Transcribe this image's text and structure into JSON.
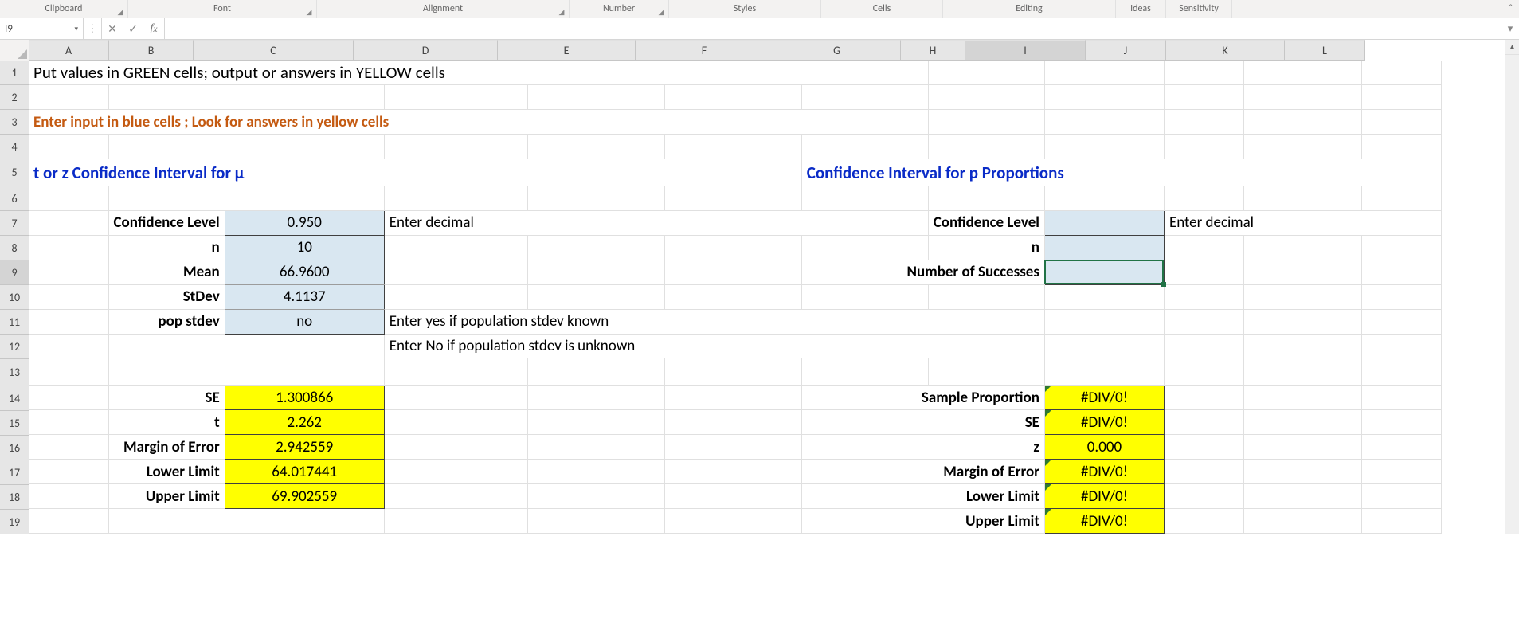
{
  "ribbon": {
    "groups": [
      "Clipboard",
      "Font",
      "Alignment",
      "Number",
      "Styles",
      "Cells",
      "Editing",
      "Ideas",
      "Sensitivity"
    ]
  },
  "name_box": "I9",
  "formula": "",
  "columns": {
    "labels": [
      "A",
      "B",
      "C",
      "D",
      "E",
      "F",
      "G",
      "H",
      "I",
      "J",
      "K",
      "L"
    ],
    "widths": [
      100,
      105,
      200,
      180,
      172,
      172,
      159,
      80,
      150,
      100,
      148,
      100
    ]
  },
  "rows": [
    1,
    2,
    3,
    4,
    5,
    6,
    7,
    8,
    9,
    10,
    11,
    12,
    13,
    14,
    15,
    16,
    17,
    18,
    19
  ],
  "row_heights": {
    "1": 30,
    "2": 30,
    "3": 30,
    "4": 30,
    "5": 33,
    "6": 30,
    "7": 30,
    "8": 30,
    "9": 30,
    "10": 30,
    "11": 30,
    "12": 30,
    "13": 33,
    "14": 30,
    "15": 30,
    "16": 30,
    "17": 30,
    "18": 30,
    "19": 30
  },
  "active_cell": {
    "col": "I",
    "row": 9
  },
  "cells": {
    "row1": "Put values in GREEN cells; output or answers in YELLOW cells",
    "row3": "Enter input in blue cells ; Look for answers in yellow cells",
    "row5_left": "t  or z Confidence Interval for μ",
    "row5_right": "Confidence Interval for p Proportions",
    "left": {
      "conf_level_label": "Confidence Level",
      "conf_level_value": "0.950",
      "conf_level_hint": "Enter decimal",
      "n_label": "n",
      "n_value": "10",
      "mean_label": "Mean",
      "mean_value": "66.9600",
      "stdev_label": "StDev",
      "stdev_value": "4.1137",
      "popstdev_label": "pop stdev",
      "popstdev_value": "no",
      "popstdev_hint1": "Enter yes if population stdev known",
      "popstdev_hint2": "Enter No if population stdev is unknown",
      "se_label": "SE",
      "se_value": "1.300866",
      "t_label": "t",
      "t_value": "2.262",
      "me_label": "Margin of Error",
      "me_value": "2.942559",
      "ll_label": "Lower Limit",
      "ll_value": "64.017441",
      "ul_label": "Upper Limit",
      "ul_value": "69.902559"
    },
    "right": {
      "conf_level_label": "Confidence Level",
      "conf_level_value": "",
      "conf_level_hint": "Enter decimal",
      "n_label": "n",
      "n_value": "",
      "succ_label": "Number of Successes",
      "succ_value": "",
      "sp_label": "Sample Proportion",
      "sp_value": "#DIV/0!",
      "se_label": "SE",
      "se_value": "#DIV/0!",
      "z_label": "z",
      "z_value": "0.000",
      "me_label": "Margin of Error",
      "me_value": "#DIV/0!",
      "ll_label": "Lower Limit",
      "ll_value": "#DIV/0!",
      "ul_label": "Upper Limit",
      "ul_value": "#DIV/0!"
    }
  }
}
